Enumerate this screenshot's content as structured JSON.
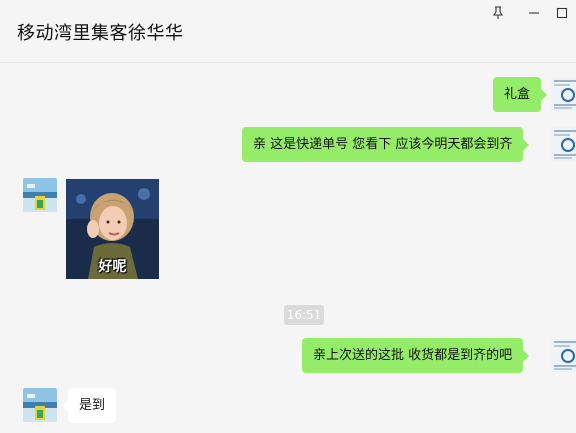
{
  "window": {
    "title": "移动湾里集客徐华华",
    "controls": {
      "pin_icon": "pin-icon",
      "minimize_icon": "minimize-icon",
      "maximize_icon": "maximize-icon"
    }
  },
  "messages": [
    {
      "sender": "me",
      "type": "text",
      "text": "礼盒"
    },
    {
      "sender": "me",
      "type": "text",
      "text": "亲 这是快递单号 您看下 应该今明天都会到齐"
    },
    {
      "sender": "them",
      "type": "sticker",
      "caption": "好呢"
    },
    {
      "type": "time",
      "text": "16:51"
    },
    {
      "sender": "me",
      "type": "text",
      "text": "亲上次送的这批  收货都是到齐的吧"
    },
    {
      "sender": "them",
      "type": "text",
      "text": "是到"
    }
  ],
  "colors": {
    "background": "#f5f5f5",
    "my_bubble": "#95ec69",
    "their_bubble": "#ffffff",
    "time_pill": "#dadada"
  }
}
